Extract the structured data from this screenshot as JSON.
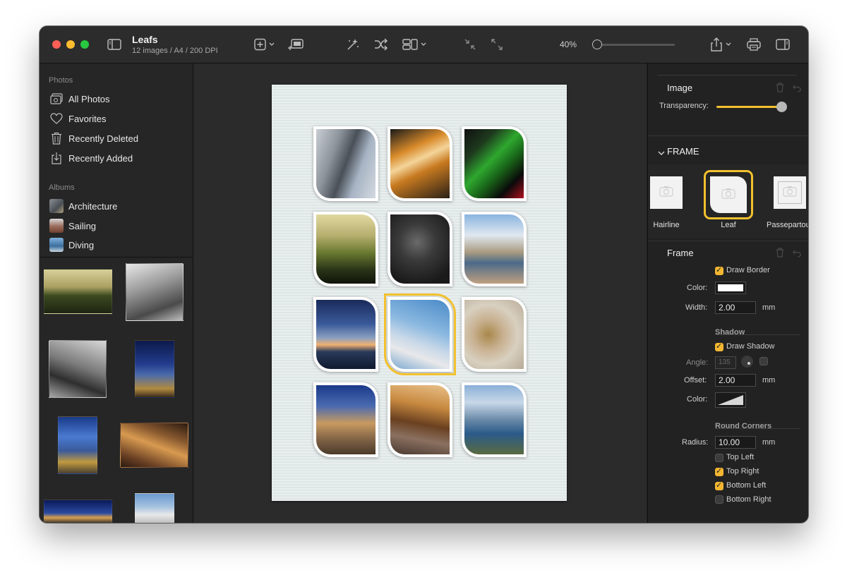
{
  "toolbar": {
    "title": "Leafs",
    "subtitle": "12 images / A4 / 200 DPI",
    "zoom": "40%",
    "zoom_level": 0.0
  },
  "sidebar": {
    "photos_label": "Photos",
    "photos_items": [
      {
        "label": "All Photos",
        "icon": "photos-icon"
      },
      {
        "label": "Favorites",
        "icon": "heart-icon"
      },
      {
        "label": "Recently Deleted",
        "icon": "trash-icon"
      },
      {
        "label": "Recently Added",
        "icon": "import-icon"
      }
    ],
    "albums_label": "Albums",
    "albums": [
      {
        "label": "Architecture"
      },
      {
        "label": "Sailing"
      },
      {
        "label": "Diving"
      }
    ]
  },
  "inspector": {
    "image_header": "Image",
    "transparency_label": "Transparency:",
    "transparency_value": 1.0,
    "frame_section": "FRAME",
    "frame_types": [
      {
        "label": "Hairline",
        "selected": false
      },
      {
        "label": "Leaf",
        "selected": true
      },
      {
        "label": "Passepartout",
        "selected": false
      }
    ],
    "frame_header": "Frame",
    "draw_border_label": "Draw Border",
    "draw_border": true,
    "color_label": "Color:",
    "border_color": "#ffffff",
    "width_label": "Width:",
    "width_value": "2.00",
    "unit": "mm",
    "shadow_label": "Shadow",
    "draw_shadow_label": "Draw Shadow",
    "draw_shadow": true,
    "angle_label": "Angle:",
    "angle_value": "135",
    "offset_label": "Offset:",
    "offset_value": "2.00",
    "shadow_color_label": "Color:",
    "round_corners_label": "Round Corners",
    "radius_label": "Radius:",
    "radius_value": "10.00",
    "corners": [
      {
        "label": "Top Left",
        "checked": false
      },
      {
        "label": "Top Right",
        "checked": true
      },
      {
        "label": "Bottom Left",
        "checked": true
      },
      {
        "label": "Bottom Right",
        "checked": false
      }
    ]
  },
  "colors": {
    "accent": "#f2c12e",
    "window_bg": "#1f1f1f"
  }
}
